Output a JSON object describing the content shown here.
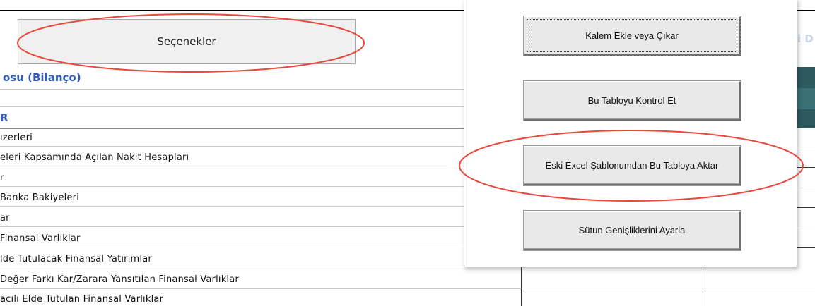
{
  "options_button": {
    "label": "Seçenekler"
  },
  "section": {
    "title": "osu (Bilanço)"
  },
  "rows": [
    {
      "text": "​R",
      "style": "head"
    },
    {
      "text": "ızerleri",
      "style": "normal"
    },
    {
      "text": "eleri Kapsamında Açılan Nakit Hesapları",
      "style": "normal"
    },
    {
      "text": "r",
      "style": "normal"
    },
    {
      "text": "Banka Bakiyeleri",
      "style": "normal"
    },
    {
      "text": "ar",
      "style": "normal"
    },
    {
      "text": "Finansal Varlıklar",
      "style": "normal"
    },
    {
      "text": "lde Tutulacak Finansal Yatırımlar",
      "style": "normal"
    },
    {
      "text": "Değer Farkı Kar/Zarara Yansıtılan Finansal Varlıklar",
      "style": "normal"
    },
    {
      "text": "acılı Elde Tutulan Finansal Varlıklar",
      "style": "normal"
    }
  ],
  "right_edge_text": "i D",
  "dialog": {
    "buttons": [
      {
        "label": "Kalem Ekle veya Çıkar",
        "focused": true
      },
      {
        "label": "Bu Tabloyu Kontrol Et",
        "focused": false
      },
      {
        "label": "Eski Excel Şablonumdan Bu Tabloya Aktar",
        "focused": false
      },
      {
        "label": "Sütun Genişliklerini Ayarla",
        "focused": false
      }
    ]
  },
  "annotation_color": "#e8473a"
}
